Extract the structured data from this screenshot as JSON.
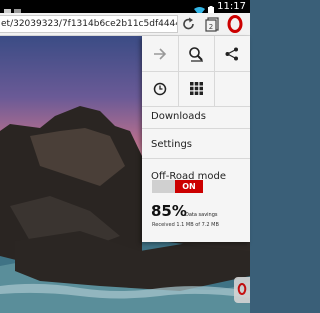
{
  "status_bar": {
    "time": "11:17"
  },
  "address_bar": {
    "url": "et/32039323/7f1314b6ce2b11c5df44446d446636b"
  },
  "menu": {
    "items": {
      "downloads": "Downloads",
      "settings": "Settings"
    },
    "off_road": {
      "title": "Off-Road mode",
      "toggle_state": "ON",
      "savings_percent": "85%",
      "savings_label": "Data savings",
      "received_text": "Received 1.1 MB of 7.2 MB"
    }
  },
  "colors": {
    "opera_red": "#cc0000",
    "menu_bg": "#f5f5f5"
  },
  "icons": {
    "grid": [
      "forward-arrow-icon",
      "find-in-page-icon",
      "share-icon",
      "history-icon",
      "speed-dial-icon",
      "discover-icon"
    ]
  }
}
